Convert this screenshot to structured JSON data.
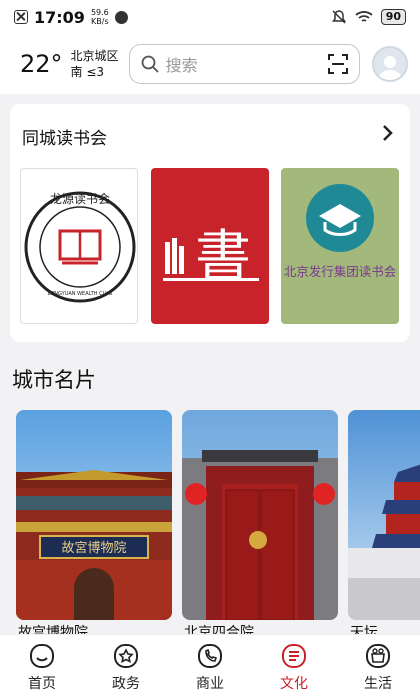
{
  "status": {
    "time": "17:09",
    "speed_value": "59.6",
    "speed_unit": "KB/s",
    "battery": "90"
  },
  "header": {
    "temperature": "22°",
    "location_line1": "北京城区",
    "location_line2": "南 ≤3",
    "search_placeholder": "搜索"
  },
  "book_club": {
    "title": "同城读书会",
    "items": [
      {
        "name": "龙源读书会",
        "subtitle": "LONGYUAN WEALTH CLUB"
      },
      {
        "name": "書"
      },
      {
        "name": "北京发行集团读书会"
      }
    ]
  },
  "city": {
    "title": "城市名片",
    "items": [
      {
        "name": "故宫博物院"
      },
      {
        "name": "北京四合院"
      },
      {
        "name": "天坛"
      }
    ],
    "sign_text": "故宮博物院"
  },
  "nav": {
    "items": [
      {
        "label": "首页",
        "icon": "home-icon"
      },
      {
        "label": "政务",
        "icon": "gov-icon"
      },
      {
        "label": "商业",
        "icon": "commerce-icon"
      },
      {
        "label": "文化",
        "icon": "culture-icon",
        "active": true
      },
      {
        "label": "生活",
        "icon": "life-icon"
      }
    ],
    "accent": "#c8222a"
  }
}
